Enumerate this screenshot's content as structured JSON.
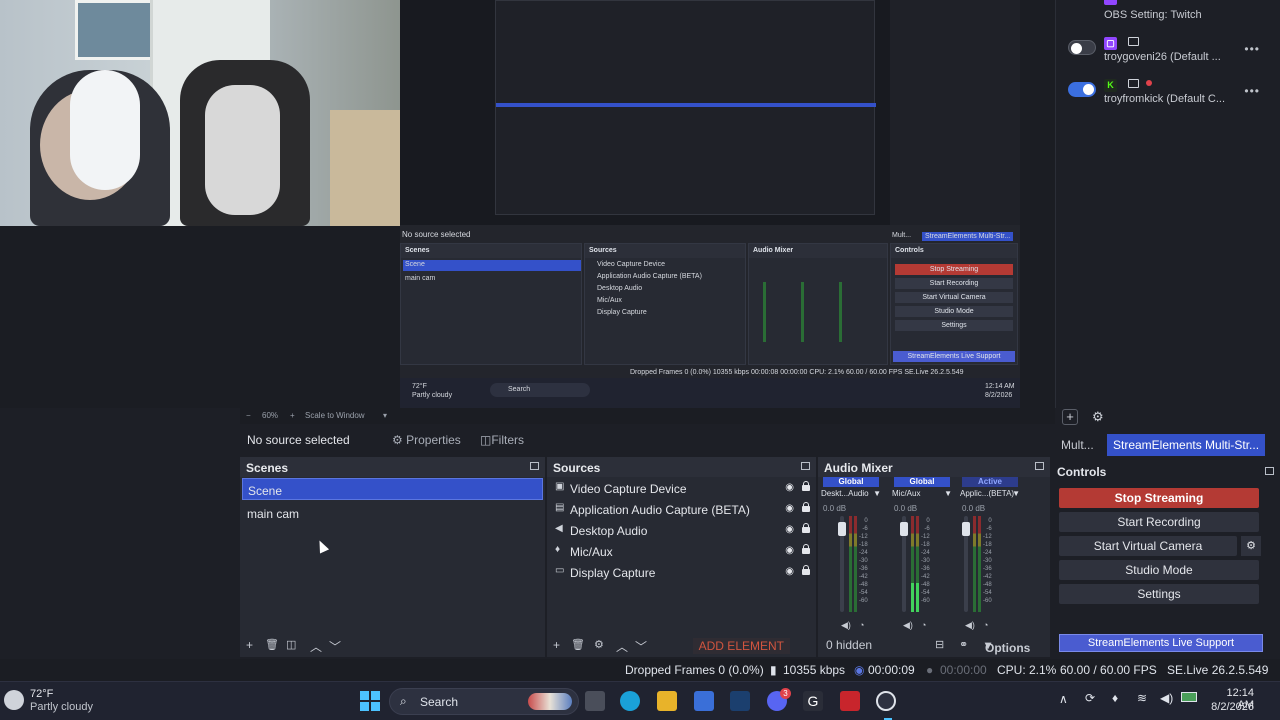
{
  "accounts": [
    {
      "name": "OBS Setting: Twitch"
    },
    {
      "name": "troygoveni26 (Default ...",
      "enabled": false
    },
    {
      "name": "troyfromkick (Default C...",
      "enabled": true
    }
  ],
  "zoom": {
    "percent": "60%",
    "mode": "Scale to Window"
  },
  "props": {
    "no_source": "No source selected",
    "properties": "Properties",
    "filters": "Filters"
  },
  "scenes": {
    "title": "Scenes",
    "items": [
      "Scene",
      "main cam"
    ],
    "selected": 0
  },
  "sources": {
    "title": "Sources",
    "items": [
      {
        "label": "Video Capture Device",
        "icon": "camera-icon"
      },
      {
        "label": "Application Audio Capture (BETA)",
        "icon": "window-icon"
      },
      {
        "label": "Desktop Audio",
        "icon": "speaker-icon"
      },
      {
        "label": "Mic/Aux",
        "icon": "mic-icon"
      },
      {
        "label": "Display Capture",
        "icon": "monitor-icon"
      }
    ],
    "add_element": "ADD ELEMENT"
  },
  "mixer": {
    "title": "Audio Mixer",
    "channels": [
      {
        "tag": "Global",
        "name": "Deskt...Audio",
        "db": "0.0 dB",
        "level": 0.0
      },
      {
        "tag": "Global",
        "name": "Mic/Aux",
        "db": "0.0 dB",
        "level": 0.3
      },
      {
        "tag": "Active",
        "name": "Applic...(BETA)",
        "db": "0.0 dB",
        "level": 0.0
      }
    ],
    "scale": [
      "0",
      "-6",
      "-12",
      "-18",
      "-24",
      "-30",
      "-36",
      "-42",
      "-48",
      "-54",
      "-60"
    ],
    "hidden": "0 hidden",
    "options": "Options"
  },
  "dock_tabs": {
    "multi": "Mult...",
    "se": "StreamElements Multi-Str..."
  },
  "controls": {
    "title": "Controls",
    "stop_streaming": "Stop Streaming",
    "start_recording": "Start Recording",
    "start_virtual_camera": "Start Virtual Camera",
    "studio_mode": "Studio Mode",
    "settings": "Settings",
    "support": "StreamElements Live Support"
  },
  "status": {
    "dropped": "Dropped Frames 0 (0.0%)",
    "kbps": "10355 kbps",
    "stream_time": "00:00:09",
    "rec_time": "00:00:00",
    "cpu": "CPU: 2.1%",
    "fps": "60.00 / 60.00 FPS",
    "version": "SE.Live 26.2.5.549"
  },
  "taskbar": {
    "temp": "72°F",
    "weather": "Partly cloudy",
    "search": "Search",
    "time": "12:14 AM",
    "date": "8/2/2026",
    "discord_badge": "3"
  },
  "nested": {
    "no_source": "No source selected",
    "scenes": "Scenes",
    "sources": "Sources",
    "mixer": "Audio Mixer",
    "controls": "Controls",
    "scene_items": [
      "Scene",
      "main cam"
    ],
    "source_items": [
      "Video Capture Device",
      "Application Audio Capture (BETA)",
      "Desktop Audio",
      "Mic/Aux",
      "Display Capture"
    ],
    "ctrl_items": [
      "Stop Streaming",
      "Start Recording",
      "Start Virtual Camera",
      "Studio Mode",
      "Settings"
    ],
    "support": "StreamElements Live Support",
    "tabs": [
      "Mult...",
      "StreamElements Multi-Str..."
    ],
    "status": "Dropped Frames 0 (0.0%)   10355 kbps   00:00:08   00:00:00   CPU: 2.1%   60.00 / 60.00 FPS   SE.Live 26.2.5.549",
    "temp": "72°F",
    "weather": "Partly cloudy",
    "search": "Search",
    "time": "12:14 AM",
    "date": "8/2/2026"
  }
}
